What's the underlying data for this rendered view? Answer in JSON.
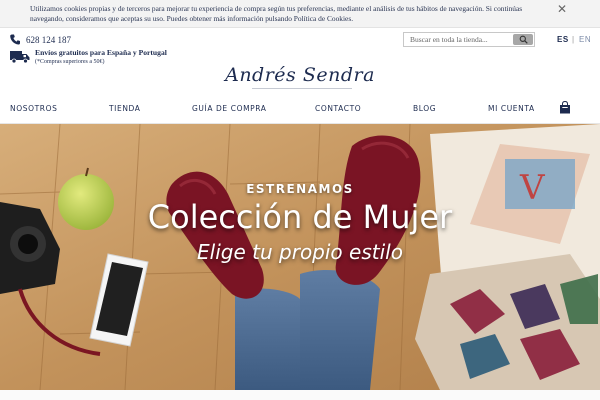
{
  "cookie_bar": {
    "text": "Utilizamos cookies propias y de terceros para mejorar tu experiencia de compra según tus preferencias, mediante el análisis de tus hábitos de navegación. Si continúas navegando, consideramos que aceptas su uso. Puedes obtener más información pulsando Política de Cookies.",
    "close_label": "✕"
  },
  "header": {
    "phone_icon": "phone-icon",
    "phone": "628 124 187",
    "shipping_icon": "truck-icon",
    "shipping_main": "Envíos gratuitos para España y Portugal",
    "shipping_sub": "(*Compras superiores a 50€)",
    "search": {
      "placeholder": "Buscar en toda la tienda...",
      "button_icon": "search-icon"
    },
    "languages": {
      "es": "ES",
      "separator": "|",
      "en": "EN"
    },
    "logo": "Andrés Sendra"
  },
  "nav": {
    "items": [
      {
        "label": "NOSOTROS"
      },
      {
        "label": "TIENDA"
      },
      {
        "label": "GUÍA DE COMPRA"
      },
      {
        "label": "CONTACTO"
      },
      {
        "label": "BLOG"
      },
      {
        "label": "MI CUENTA"
      }
    ],
    "cart_icon": "shopping-bag-icon"
  },
  "hero": {
    "overline": "ESTRENAMOS",
    "title": "Colección de Mujer",
    "subtitle": "Elige tu propio estilo"
  },
  "colors": {
    "brand_navy": "#1d2b4f",
    "cookie_bg": "#f3f3f3",
    "shoe_burgundy": "#7a1424",
    "wood": "#c79b67"
  }
}
